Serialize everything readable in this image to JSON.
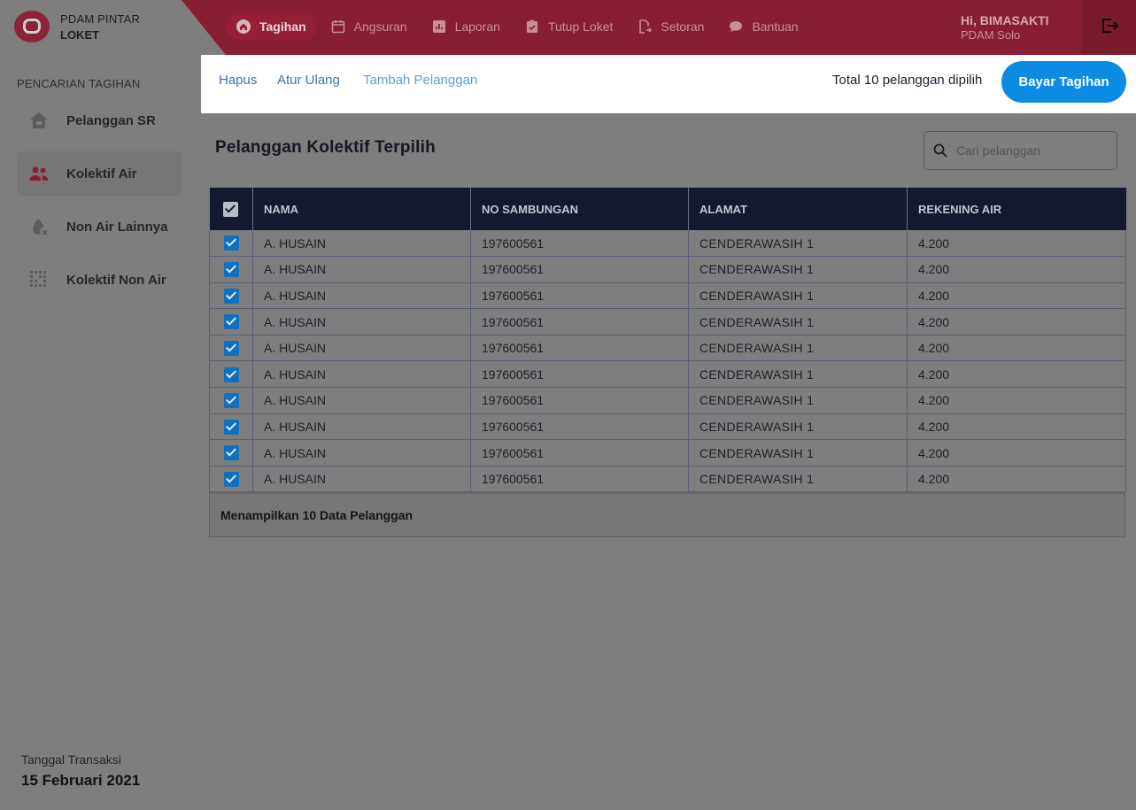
{
  "app": {
    "name": "PDAM PINTAR",
    "subtitle": "LOKET"
  },
  "nav": [
    {
      "label": "Tagihan",
      "icon": "home-icon",
      "active": true
    },
    {
      "label": "Angsuran",
      "icon": "calendar-icon"
    },
    {
      "label": "Laporan",
      "icon": "report-icon"
    },
    {
      "label": "Tutup Loket",
      "icon": "clipboard-check-icon"
    },
    {
      "label": "Setoran",
      "icon": "document-export-icon"
    },
    {
      "label": "Bantuan",
      "icon": "chat-bubble-icon"
    }
  ],
  "user": {
    "greeting": "Hi, BIMASAKTI",
    "org": "PDAM Solo"
  },
  "sidebar": {
    "heading": "PENCARIAN TAGIHAN",
    "items": [
      {
        "label": "Pelanggan SR",
        "icon": "house-icon"
      },
      {
        "label": "Kolektif Air",
        "icon": "users-icon",
        "active": true
      },
      {
        "label": "Non Air Lainnya",
        "icon": "water-drop-x-icon"
      },
      {
        "label": "Kolektif Non Air",
        "icon": "grid-dots-icon"
      }
    ],
    "transaction_label": "Tanggal Transaksi",
    "transaction_date": "15 Februari 2021"
  },
  "actions": {
    "delete": "Hapus",
    "reset": "Atur Ulang",
    "add_customer": "Tambah Pelanggan",
    "total_selected": "Total 10 pelanggan dipilih",
    "pay_button": "Bayar Tagihan"
  },
  "main": {
    "title": "Pelanggan Kolektif Terpilih",
    "search_placeholder": "Cari pelanggan",
    "columns": [
      "NAMA",
      "NO SAMBUNGAN",
      "ALAMAT",
      "REKENING AIR"
    ],
    "rows": [
      {
        "nama": "A. HUSAIN",
        "no_sambungan": "197600561",
        "alamat": "CENDERAWASIH  1",
        "rekening": "4.200"
      },
      {
        "nama": "A. HUSAIN",
        "no_sambungan": "197600561",
        "alamat": "CENDERAWASIH  1",
        "rekening": "4.200"
      },
      {
        "nama": "A. HUSAIN",
        "no_sambungan": "197600561",
        "alamat": "CENDERAWASIH  1",
        "rekening": "4.200"
      },
      {
        "nama": "A. HUSAIN",
        "no_sambungan": "197600561",
        "alamat": "CENDERAWASIH  1",
        "rekening": "4.200"
      },
      {
        "nama": "A. HUSAIN",
        "no_sambungan": "197600561",
        "alamat": "CENDERAWASIH  1",
        "rekening": "4.200"
      },
      {
        "nama": "A. HUSAIN",
        "no_sambungan": "197600561",
        "alamat": "CENDERAWASIH  1",
        "rekening": "4.200"
      },
      {
        "nama": "A. HUSAIN",
        "no_sambungan": "197600561",
        "alamat": "CENDERAWASIH  1",
        "rekening": "4.200"
      },
      {
        "nama": "A. HUSAIN",
        "no_sambungan": "197600561",
        "alamat": "CENDERAWASIH  1",
        "rekening": "4.200"
      },
      {
        "nama": "A. HUSAIN",
        "no_sambungan": "197600561",
        "alamat": "CENDERAWASIH  1",
        "rekening": "4.200"
      },
      {
        "nama": "A. HUSAIN",
        "no_sambungan": "197600561",
        "alamat": "CENDERAWASIH  1",
        "rekening": "4.200"
      }
    ],
    "footer": "Menampilkan 10 Data Pelanggan"
  },
  "colors": {
    "brand_red": "#871e31",
    "pay_button": "#0b8be3",
    "link": "#3b74b0",
    "link_light": "#5aa0d3",
    "table_header": "#131a30",
    "checkbox": "#0f70c0"
  }
}
